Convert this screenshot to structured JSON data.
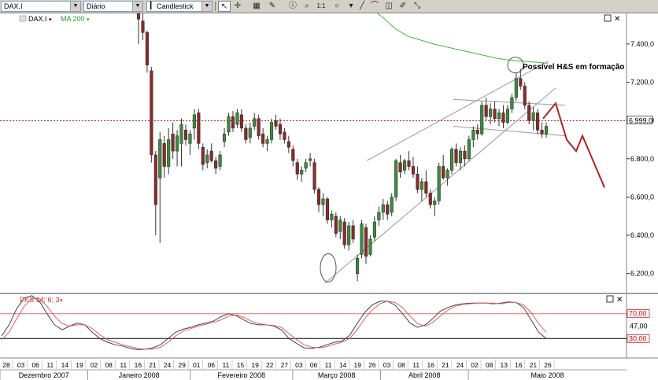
{
  "toolbar": {
    "symbol": "DAX.I",
    "period": "Diário",
    "chart_style": "Candlestick",
    "icons": [
      "cursor-arrow-icon",
      "crosshair-icon",
      "grid-icon",
      "pencil-icon",
      "info-icon",
      "zoom-icon",
      "one-to-one-icon",
      "ellipse-icon",
      "line-icon",
      "brush-icon",
      "eraser-icon",
      "draw-icon",
      "arrows-icon"
    ]
  },
  "legend": {
    "instrument": "DAX.I",
    "ma_label": "MA 200",
    "instrument_color": "#000000",
    "ma_color": "#2a9d2a"
  },
  "annotation": "Possível H&S em formação",
  "last_price_label": "6.999,0",
  "colors": {
    "up": "#3c8c3c",
    "down": "#8c2a2a",
    "ma": "#49b049",
    "projection": "#b22222",
    "ref_line": "#cc0000",
    "stoch_k": "#444444",
    "stoch_d": "#e06060",
    "trend": "#999999"
  },
  "chart_data": [
    {
      "type": "candlestick",
      "ylim": [
        6100,
        7560
      ],
      "y_ticks": [
        6200,
        6400,
        6600,
        6800,
        7000,
        7200,
        7400
      ],
      "y_tick_labels": [
        "6.200,0",
        "6.400,0",
        "6.600,0",
        "6.800,0",
        "7.000,0",
        "7.200,0",
        "7.400,0"
      ],
      "reference_level": 6999,
      "days": [
        "28",
        "03",
        "06",
        "11",
        "14",
        "19",
        "02",
        "08",
        "11",
        "16",
        "21",
        "24",
        "29",
        "01",
        "06",
        "11",
        "15",
        "19",
        "22",
        "27",
        "03",
        "06",
        "11",
        "14",
        "19",
        "26",
        "03",
        "08",
        "11",
        "16",
        "21",
        "24",
        "02",
        "08",
        "13",
        "16",
        "21",
        "26"
      ],
      "months": [
        {
          "label": "Dezembro 2007",
          "start": 0,
          "end": 6
        },
        {
          "label": "Janeiro 2008",
          "start": 6,
          "end": 13
        },
        {
          "label": "Fevereiro 2008",
          "start": 13,
          "end": 20
        },
        {
          "label": "Março 2008",
          "start": 20,
          "end": 26
        },
        {
          "label": "Abril 2008",
          "start": 26,
          "end": 32
        },
        {
          "label": "Maio 2008",
          "start": 32,
          "end": 38
        }
      ],
      "candles": [
        {
          "o": 7580,
          "h": 7600,
          "l": 7400,
          "c": 7530
        },
        {
          "o": 7520,
          "h": 7560,
          "l": 7420,
          "c": 7460
        },
        {
          "o": 7460,
          "h": 7470,
          "l": 7250,
          "c": 7290
        },
        {
          "o": 7260,
          "h": 7280,
          "l": 6780,
          "c": 6820
        },
        {
          "o": 6820,
          "h": 6840,
          "l": 6400,
          "c": 6560
        },
        {
          "o": 6700,
          "h": 6940,
          "l": 6360,
          "c": 6900
        },
        {
          "o": 6880,
          "h": 6920,
          "l": 6700,
          "c": 6760
        },
        {
          "o": 6760,
          "h": 6960,
          "l": 6720,
          "c": 6900
        },
        {
          "o": 6930,
          "h": 6990,
          "l": 6800,
          "c": 6840
        },
        {
          "o": 6840,
          "h": 6950,
          "l": 6760,
          "c": 6920
        },
        {
          "o": 6880,
          "h": 7010,
          "l": 6760,
          "c": 6980
        },
        {
          "o": 6950,
          "h": 6980,
          "l": 6870,
          "c": 6900
        },
        {
          "o": 6880,
          "h": 6950,
          "l": 6820,
          "c": 6930
        },
        {
          "o": 6960,
          "h": 7060,
          "l": 6900,
          "c": 7030
        },
        {
          "o": 7040,
          "h": 7060,
          "l": 6850,
          "c": 6880
        },
        {
          "o": 6860,
          "h": 6880,
          "l": 6740,
          "c": 6770
        },
        {
          "o": 6780,
          "h": 6850,
          "l": 6750,
          "c": 6820
        },
        {
          "o": 6840,
          "h": 6880,
          "l": 6780,
          "c": 6790
        },
        {
          "o": 6790,
          "h": 6810,
          "l": 6720,
          "c": 6750
        },
        {
          "o": 6760,
          "h": 6840,
          "l": 6740,
          "c": 6820
        },
        {
          "o": 6890,
          "h": 6960,
          "l": 6860,
          "c": 6930
        },
        {
          "o": 6940,
          "h": 7040,
          "l": 6920,
          "c": 7020
        },
        {
          "o": 7020,
          "h": 7050,
          "l": 6940,
          "c": 6960
        },
        {
          "o": 6980,
          "h": 7060,
          "l": 6960,
          "c": 7040
        },
        {
          "o": 7030,
          "h": 7060,
          "l": 6940,
          "c": 6960
        },
        {
          "o": 6960,
          "h": 6980,
          "l": 6880,
          "c": 6900
        },
        {
          "o": 6910,
          "h": 6990,
          "l": 6880,
          "c": 6960
        },
        {
          "o": 6970,
          "h": 7040,
          "l": 6950,
          "c": 7010
        },
        {
          "o": 7010,
          "h": 7030,
          "l": 6900,
          "c": 6920
        },
        {
          "o": 6930,
          "h": 6960,
          "l": 6860,
          "c": 6880
        },
        {
          "o": 6880,
          "h": 6920,
          "l": 6840,
          "c": 6900
        },
        {
          "o": 6900,
          "h": 7010,
          "l": 6880,
          "c": 6990
        },
        {
          "o": 7000,
          "h": 7030,
          "l": 6950,
          "c": 6970
        },
        {
          "o": 6980,
          "h": 7010,
          "l": 6900,
          "c": 6930
        },
        {
          "o": 6940,
          "h": 6960,
          "l": 6880,
          "c": 6900
        },
        {
          "o": 6890,
          "h": 6920,
          "l": 6830,
          "c": 6860
        },
        {
          "o": 6850,
          "h": 6870,
          "l": 6760,
          "c": 6790
        },
        {
          "o": 6780,
          "h": 6800,
          "l": 6690,
          "c": 6720
        },
        {
          "o": 6720,
          "h": 6760,
          "l": 6680,
          "c": 6740
        },
        {
          "o": 6750,
          "h": 6800,
          "l": 6730,
          "c": 6780
        },
        {
          "o": 6790,
          "h": 6830,
          "l": 6760,
          "c": 6800
        },
        {
          "o": 6780,
          "h": 6800,
          "l": 6620,
          "c": 6640
        },
        {
          "o": 6640,
          "h": 6650,
          "l": 6520,
          "c": 6560
        },
        {
          "o": 6560,
          "h": 6620,
          "l": 6500,
          "c": 6590
        },
        {
          "o": 6590,
          "h": 6600,
          "l": 6460,
          "c": 6480
        },
        {
          "o": 6480,
          "h": 6530,
          "l": 6440,
          "c": 6510
        },
        {
          "o": 6500,
          "h": 6520,
          "l": 6390,
          "c": 6410
        },
        {
          "o": 6420,
          "h": 6500,
          "l": 6380,
          "c": 6480
        },
        {
          "o": 6470,
          "h": 6490,
          "l": 6330,
          "c": 6350
        },
        {
          "o": 6350,
          "h": 6470,
          "l": 6320,
          "c": 6450
        },
        {
          "o": 6450,
          "h": 6480,
          "l": 6360,
          "c": 6380
        },
        {
          "o": 6200,
          "h": 6300,
          "l": 6160,
          "c": 6280
        },
        {
          "o": 6300,
          "h": 6480,
          "l": 6280,
          "c": 6460
        },
        {
          "o": 6440,
          "h": 6460,
          "l": 6250,
          "c": 6290
        },
        {
          "o": 6300,
          "h": 6400,
          "l": 6290,
          "c": 6380
        },
        {
          "o": 6390,
          "h": 6500,
          "l": 6370,
          "c": 6470
        },
        {
          "o": 6480,
          "h": 6550,
          "l": 6450,
          "c": 6520
        },
        {
          "o": 6520,
          "h": 6590,
          "l": 6480,
          "c": 6560
        },
        {
          "o": 6560,
          "h": 6580,
          "l": 6480,
          "c": 6510
        },
        {
          "o": 6520,
          "h": 6620,
          "l": 6500,
          "c": 6600
        },
        {
          "o": 6600,
          "h": 6800,
          "l": 6580,
          "c": 6790
        },
        {
          "o": 6780,
          "h": 6820,
          "l": 6700,
          "c": 6730
        },
        {
          "o": 6740,
          "h": 6800,
          "l": 6720,
          "c": 6790
        },
        {
          "o": 6790,
          "h": 6840,
          "l": 6740,
          "c": 6760
        },
        {
          "o": 6760,
          "h": 6810,
          "l": 6700,
          "c": 6720
        },
        {
          "o": 6720,
          "h": 6760,
          "l": 6620,
          "c": 6640
        },
        {
          "o": 6640,
          "h": 6700,
          "l": 6580,
          "c": 6680
        },
        {
          "o": 6680,
          "h": 6740,
          "l": 6600,
          "c": 6620
        },
        {
          "o": 6620,
          "h": 6640,
          "l": 6540,
          "c": 6560
        },
        {
          "o": 6560,
          "h": 6600,
          "l": 6500,
          "c": 6580
        },
        {
          "o": 6580,
          "h": 6780,
          "l": 6560,
          "c": 6760
        },
        {
          "o": 6760,
          "h": 6820,
          "l": 6690,
          "c": 6700
        },
        {
          "o": 6700,
          "h": 6750,
          "l": 6660,
          "c": 6740
        },
        {
          "o": 6740,
          "h": 6860,
          "l": 6720,
          "c": 6850
        },
        {
          "o": 6850,
          "h": 6880,
          "l": 6760,
          "c": 6780
        },
        {
          "o": 6780,
          "h": 6860,
          "l": 6740,
          "c": 6840
        },
        {
          "o": 6840,
          "h": 6870,
          "l": 6760,
          "c": 6800
        },
        {
          "o": 6800,
          "h": 6920,
          "l": 6790,
          "c": 6900
        },
        {
          "o": 6900,
          "h": 6970,
          "l": 6860,
          "c": 6950
        },
        {
          "o": 6950,
          "h": 6980,
          "l": 6900,
          "c": 6930
        },
        {
          "o": 6930,
          "h": 7100,
          "l": 6920,
          "c": 7080
        },
        {
          "o": 7080,
          "h": 7120,
          "l": 7000,
          "c": 7020
        },
        {
          "o": 7020,
          "h": 7090,
          "l": 6980,
          "c": 7060
        },
        {
          "o": 7060,
          "h": 7100,
          "l": 6990,
          "c": 7010
        },
        {
          "o": 7010,
          "h": 7060,
          "l": 6970,
          "c": 7040
        },
        {
          "o": 7040,
          "h": 7080,
          "l": 6960,
          "c": 6990
        },
        {
          "o": 6990,
          "h": 7080,
          "l": 6980,
          "c": 7060
        },
        {
          "o": 7060,
          "h": 7140,
          "l": 7040,
          "c": 7120
        },
        {
          "o": 7120,
          "h": 7250,
          "l": 7100,
          "c": 7220
        },
        {
          "o": 7220,
          "h": 7270,
          "l": 7160,
          "c": 7180
        },
        {
          "o": 7180,
          "h": 7200,
          "l": 7060,
          "c": 7080
        },
        {
          "o": 7080,
          "h": 7100,
          "l": 6980,
          "c": 7000
        },
        {
          "o": 7000,
          "h": 7070,
          "l": 6950,
          "c": 7040
        },
        {
          "o": 7040,
          "h": 7060,
          "l": 6930,
          "c": 6950
        },
        {
          "o": 6950,
          "h": 6990,
          "l": 6910,
          "c": 6930
        },
        {
          "o": 6930,
          "h": 6990,
          "l": 6910,
          "c": 6970
        }
      ],
      "ma_200": [
        7590,
        7540,
        7480,
        7440,
        7420,
        7400,
        7385,
        7370,
        7355,
        7340,
        7325,
        7315,
        7310,
        7305,
        7300
      ],
      "projection": [
        7080,
        7010,
        6950,
        6930,
        6910,
        6870,
        6800,
        6740,
        6690,
        6640
      ]
    },
    {
      "type": "line",
      "title": "PKS 14; 6; 3",
      "ylim": [
        0,
        100
      ],
      "levels": [
        70,
        30
      ],
      "level_labels": [
        "70,00",
        "30,00"
      ],
      "mid_label": "47,00",
      "series": [
        {
          "name": "%K",
          "values": [
            34,
            52,
            78,
            95,
            99,
            90,
            70,
            52,
            44,
            50,
            55,
            52,
            40,
            30,
            24,
            20,
            18,
            14,
            12,
            13,
            15,
            20,
            30,
            40,
            45,
            48,
            52,
            55,
            58,
            65,
            70,
            67,
            60,
            54,
            52,
            52,
            50,
            44,
            30,
            22,
            15,
            14,
            16,
            20,
            24,
            26,
            35,
            54,
            72,
            84,
            90,
            90,
            84,
            70,
            55,
            48,
            52,
            62,
            74,
            80,
            84,
            86,
            87,
            87,
            87,
            86,
            87,
            89,
            88,
            80,
            60,
            40,
            30
          ]
        },
        {
          "name": "%D",
          "values": [
            28,
            40,
            62,
            82,
            94,
            94,
            82,
            66,
            54,
            50,
            52,
            52,
            46,
            36,
            28,
            24,
            20,
            17,
            14,
            13,
            13,
            16,
            24,
            34,
            42,
            46,
            50,
            53,
            56,
            60,
            66,
            68,
            64,
            58,
            54,
            52,
            51,
            48,
            38,
            28,
            20,
            16,
            15,
            17,
            21,
            24,
            30,
            44,
            62,
            76,
            86,
            90,
            88,
            80,
            66,
            54,
            50,
            56,
            66,
            76,
            82,
            85,
            86,
            87,
            87,
            87,
            86,
            88,
            88,
            84,
            72,
            54,
            40
          ]
        }
      ]
    }
  ]
}
